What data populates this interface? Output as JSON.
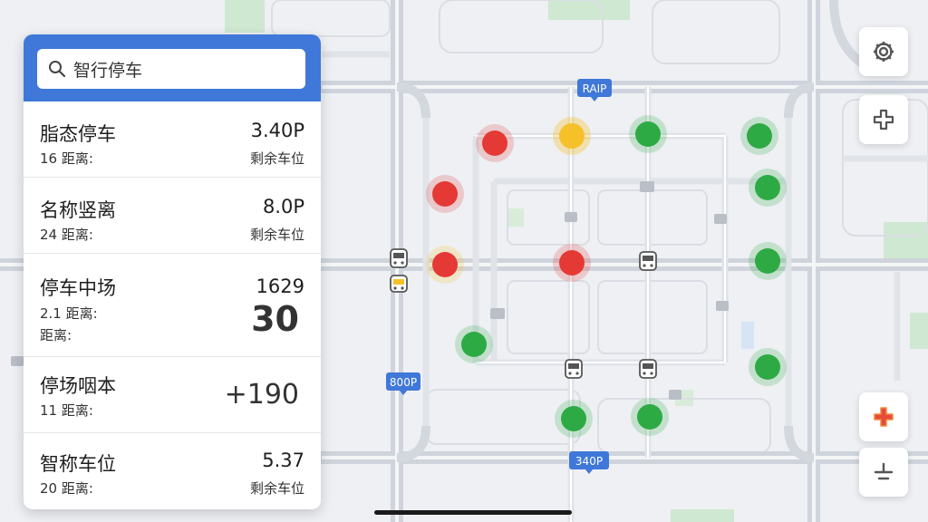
{
  "search": {
    "placeholder": "智行停车"
  },
  "parking_list": [
    {
      "name": "脂态停车",
      "distance": "16 距离:",
      "value": "3.40P",
      "sub": "剩余车位"
    },
    {
      "name": "名称竖离",
      "distance": "24 距离:",
      "value": "8.0P",
      "sub": "剩余车位"
    },
    {
      "name": "停车中场",
      "distance": "2.1 距离:",
      "distance2": "距离:",
      "value": "1629",
      "big": "30"
    },
    {
      "name": "停场咽本",
      "distance": "11 距离:",
      "big": "+190"
    },
    {
      "name": "智称车位",
      "distance": "20 距离:",
      "value": "5.37",
      "sub": "剩余车位"
    }
  ],
  "map_labels": {
    "top": "RAIP",
    "left": "800P",
    "bottom": "340P"
  },
  "colors": {
    "panel_header": "#3f78d8",
    "full": "#e53935",
    "limited": "#f5c02a",
    "available": "#2eaa44",
    "road": "#d3d7de",
    "park": "#cfe8d2"
  },
  "icons": {
    "search": "search-icon",
    "settings": "gear-icon",
    "add": "plus-icon",
    "location": "location-icon",
    "zoom_out": "minus-icon",
    "bus": "bus-icon"
  }
}
